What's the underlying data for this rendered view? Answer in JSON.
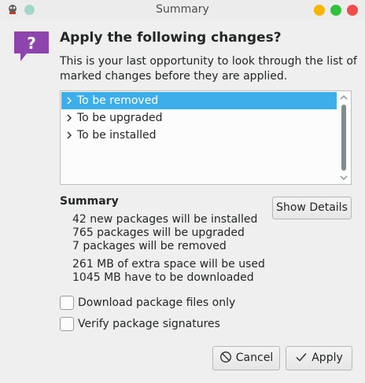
{
  "window": {
    "title": "Summary"
  },
  "header": {
    "heading": "Apply the following changes?",
    "description": "This is your last opportunity to look through the list of marked changes before they are applied."
  },
  "changes_tree": {
    "items": [
      {
        "label": "To be removed",
        "selected": true
      },
      {
        "label": "To be upgraded",
        "selected": false
      },
      {
        "label": "To be installed",
        "selected": false
      }
    ]
  },
  "summary": {
    "title": "Summary",
    "show_details_label": "Show Details",
    "package_lines": [
      "42 new packages will be installed",
      "765 packages will be upgraded",
      "7 packages will be removed"
    ],
    "space_lines": [
      "261 MB of extra space will be used",
      "1045 MB have to be downloaded"
    ]
  },
  "options": {
    "download_only": {
      "label": "Download package files only",
      "checked": false
    },
    "verify_signatures": {
      "label": "Verify package signatures",
      "checked": false
    }
  },
  "buttons": {
    "cancel_label": "Cancel",
    "apply_label": "Apply"
  },
  "colors": {
    "selection": "#3daee9",
    "question_icon": "#8e44ad",
    "minimize": "#f7b500",
    "maximize": "#2fc23a",
    "close": "#f34a4a"
  }
}
